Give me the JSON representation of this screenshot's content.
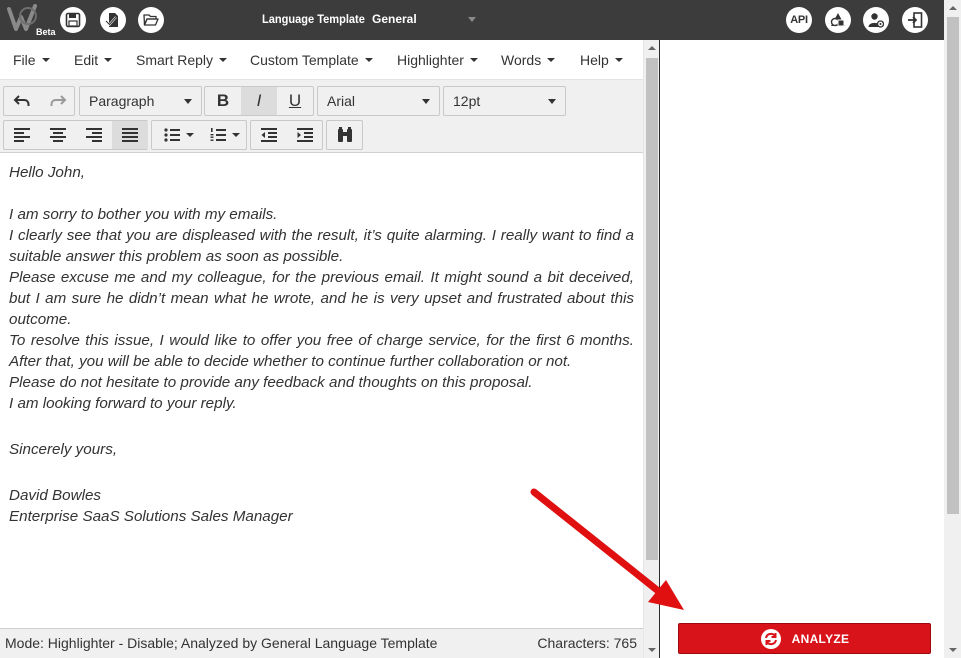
{
  "header": {
    "logo_badge": "Beta",
    "template_label": "Language Template",
    "template_value": "General",
    "api_label": "API",
    "icons": [
      "save-icon",
      "check-document-icon",
      "folder-open-icon",
      "api-icon",
      "shapes-icon",
      "user-settings-icon",
      "logout-icon"
    ]
  },
  "menu": {
    "file": "File",
    "edit": "Edit",
    "smart_reply": "Smart Reply",
    "custom_template": "Custom Template",
    "highlighter": "Highlighter",
    "words": "Words",
    "help": "Help"
  },
  "toolbar": {
    "block_format": "Paragraph",
    "font_family": "Arial",
    "font_size": "12pt",
    "bold_label": "B",
    "italic_label": "I",
    "underline_label": "U",
    "italic_active": true,
    "justify_active": true
  },
  "editor": {
    "greeting": "Hello John,",
    "p1": "I am sorry to bother you with my emails.",
    "p2": "I clearly see that you are displeased with the result, it’s quite alarming. I really want to find a suitable answer this problem as soon as possible.",
    "p3": "Please excuse me and my colleague, for the previous email. It might sound a bit deceived, but I am sure he didn’t mean what he wrote, and he is very upset and frustrated about this outcome.",
    "p4": "To resolve this issue, I would like to offer you free of charge service, for the first 6 months. After that, you will be able to decide whether to continue further collaboration or not.",
    "p5": "Please do not hesitate to provide any feedback and thoughts on this proposal.",
    "p6": "I am looking forward to your reply.",
    "closing": "Sincerely yours,",
    "signature_name": "David Bowles",
    "signature_title": "Enterprise SaaS Solutions Sales Manager"
  },
  "status": {
    "mode": "Mode: Highlighter - Disable; Analyzed by General Language Template",
    "characters": "Characters: 765"
  },
  "analyze": {
    "label": "ANALYZE"
  },
  "colors": {
    "topbar": "#3c3c3c",
    "accent_red": "#d9131a",
    "annotation_arrow": "#e01010"
  }
}
